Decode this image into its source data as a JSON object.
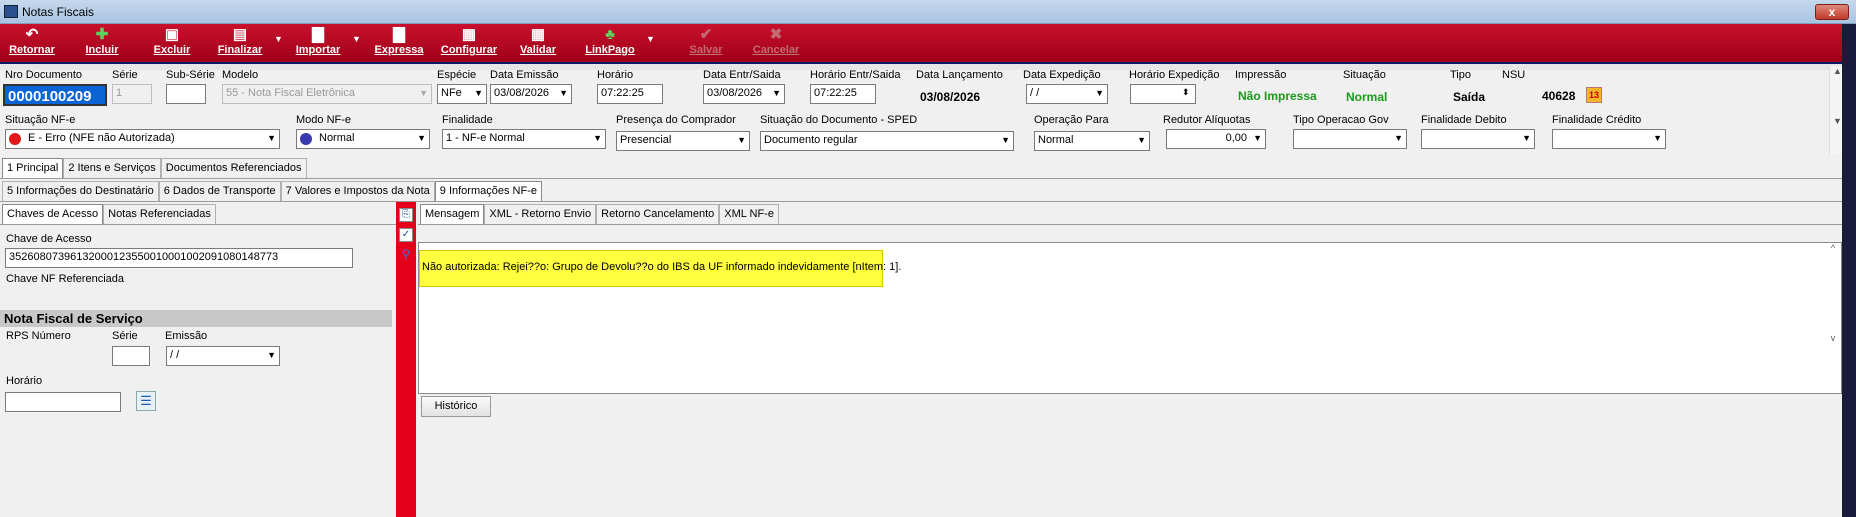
{
  "window": {
    "title": "Notas Fiscais",
    "close": "x"
  },
  "toolbar": {
    "retornar": "Retornar",
    "incluir": "Incluir",
    "excluir": "Excluir",
    "finalizar": "Finalizar",
    "importar": "Importar",
    "expressa": "Expressa",
    "configurar": "Configurar",
    "validar": "Validar",
    "linkpago": "LinkPago",
    "salvar": "Salvar",
    "cancelar": "Cancelar"
  },
  "header": {
    "nro_documento": {
      "label": "Nro Documento",
      "value": "0000100209"
    },
    "serie": {
      "label": "Série",
      "value": "1"
    },
    "sub_serie": {
      "label": "Sub-Série",
      "value": ""
    },
    "modelo": {
      "label": "Modelo",
      "value": "55 - Nota Fiscal Eletrônica"
    },
    "especie": {
      "label": "Espécie",
      "value": "NFe"
    },
    "data_emissao": {
      "label": "Data Emissão",
      "value": "03/08/2026"
    },
    "horario": {
      "label": "Horário",
      "value": "07:22:25"
    },
    "data_entr_saida": {
      "label": "Data Entr/Saida",
      "value": "03/08/2026"
    },
    "horario_entr_saida": {
      "label": "Horário Entr/Saida",
      "value": "07:22:25"
    },
    "data_lancamento": {
      "label": "Data Lançamento",
      "value": "03/08/2026"
    },
    "data_expedicao": {
      "label": "Data Expedição",
      "value": " / /"
    },
    "horario_expedicao": {
      "label": "Horário Expedição",
      "value": ""
    },
    "impressao": {
      "label": "Impressão",
      "value": "Não Impressa"
    },
    "situacao": {
      "label": "Situação",
      "value": "Normal"
    },
    "tipo": {
      "label": "Tipo",
      "value": "Saída"
    },
    "nsu": {
      "label": "NSU",
      "value": "40628",
      "badge": "13"
    },
    "situacao_nfe": {
      "label": "Situação NF-e",
      "value": "E - Erro (NFE não Autorizada)"
    },
    "modo_nfe": {
      "label": "Modo NF-e",
      "value": "Normal"
    },
    "finalidade": {
      "label": "Finalidade",
      "value": "1 - NF-e Normal"
    },
    "presenca": {
      "label": "Presença do Comprador",
      "value": "Presencial"
    },
    "situacao_sped": {
      "label": "Situação do Documento - SPED",
      "value": "Documento regular"
    },
    "operacao_para": {
      "label": "Operação Para",
      "value": "Normal"
    },
    "redutor": {
      "label": "Redutor Alíquotas",
      "value": "0,00"
    },
    "tipo_operacao_gov": {
      "label": "Tipo Operacao Gov",
      "value": ""
    },
    "finalidade_debito": {
      "label": "Finalidade Debito",
      "value": ""
    },
    "finalidade_credito": {
      "label": "Finalidade Crédito",
      "value": ""
    }
  },
  "tabs_row1": [
    "1 Principal",
    "2 Itens e Serviços",
    "Documentos Referenciados"
  ],
  "tabs_row2": [
    "5 Informações do Destinatário",
    "6 Dados de Transporte",
    "7 Valores e Impostos da Nota",
    "9 Informações NF-e"
  ],
  "left_tabs": [
    "Chaves de Acesso",
    "Notas Referenciadas"
  ],
  "chave": {
    "label": "Chave de Acesso",
    "value": "35260807396132000123550010001002091080148773",
    "ref_label": "Chave NF Referenciada"
  },
  "nfs": {
    "title": "Nota Fiscal de Serviço",
    "rps": "RPS Número",
    "serie": "Série",
    "emissao": "Emissão",
    "emissao_value": " / /",
    "horario": "Horário"
  },
  "right_tabs": [
    "Mensagem",
    "XML - Retorno Envio",
    "Retorno Cancelamento",
    "XML NF-e"
  ],
  "message": "Não autorizada: Rejei??o: Grupo de Devolu??o do IBS da UF informado indevidamente [nItem: 1].",
  "historico": "Histórico"
}
